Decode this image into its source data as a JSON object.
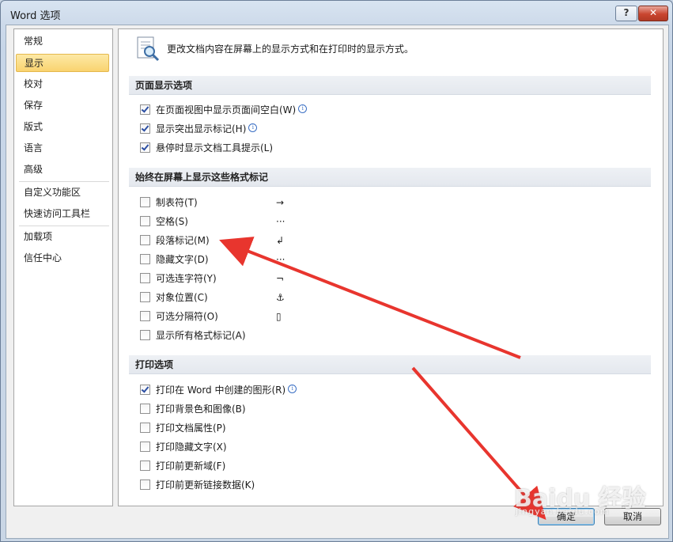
{
  "window": {
    "title": "Word 选项",
    "help_label": "?",
    "close_label": "✕"
  },
  "sidebar": {
    "items": [
      {
        "label": "常规"
      },
      {
        "label": "显示"
      },
      {
        "label": "校对"
      },
      {
        "label": "保存"
      },
      {
        "label": "版式"
      },
      {
        "label": "语言"
      },
      {
        "label": "高级"
      },
      {
        "label": "自定义功能区"
      },
      {
        "label": "快速访问工具栏"
      },
      {
        "label": "加载项"
      },
      {
        "label": "信任中心"
      }
    ],
    "selected": "显示"
  },
  "main": {
    "intro": "更改文档内容在屏幕上的显示方式和在打印时的显示方式。",
    "sections": [
      {
        "title": "页面显示选项",
        "options": [
          {
            "label": "在页面视图中显示页面间空白(W)",
            "checked": true,
            "info": true
          },
          {
            "label": "显示突出显示标记(H)",
            "checked": true,
            "info": true
          },
          {
            "label": "悬停时显示文档工具提示(L)",
            "checked": true
          }
        ]
      },
      {
        "title": "始终在屏幕上显示这些格式标记",
        "options": [
          {
            "label": "制表符(T)",
            "checked": false,
            "symbol": "→"
          },
          {
            "label": "空格(S)",
            "checked": false,
            "symbol": "···"
          },
          {
            "label": "段落标记(M)",
            "checked": false,
            "symbol": "↲"
          },
          {
            "label": "隐藏文字(D)",
            "checked": false,
            "symbol": "···"
          },
          {
            "label": "可选连字符(Y)",
            "checked": false,
            "symbol": "¬"
          },
          {
            "label": "对象位置(C)",
            "checked": false,
            "symbol": "⚓"
          },
          {
            "label": "可选分隔符(O)",
            "checked": false,
            "symbol": "▯"
          },
          {
            "label": "显示所有格式标记(A)",
            "checked": false
          }
        ]
      },
      {
        "title": "打印选项",
        "options": [
          {
            "label": "打印在 Word 中创建的图形(R)",
            "checked": true,
            "info": true
          },
          {
            "label": "打印背景色和图像(B)",
            "checked": false
          },
          {
            "label": "打印文档属性(P)",
            "checked": false
          },
          {
            "label": "打印隐藏文字(X)",
            "checked": false
          },
          {
            "label": "打印前更新域(F)",
            "checked": false
          },
          {
            "label": "打印前更新链接数据(K)",
            "checked": false
          }
        ]
      }
    ]
  },
  "footer": {
    "ok_label": "确定",
    "cancel_label": "取消"
  },
  "watermark": {
    "text": "Baidu 经验",
    "subtext": "jingyan.baidu.com"
  },
  "colors": {
    "accent_selected": "#f9d36f",
    "annotation_arrow": "#e8352e"
  }
}
